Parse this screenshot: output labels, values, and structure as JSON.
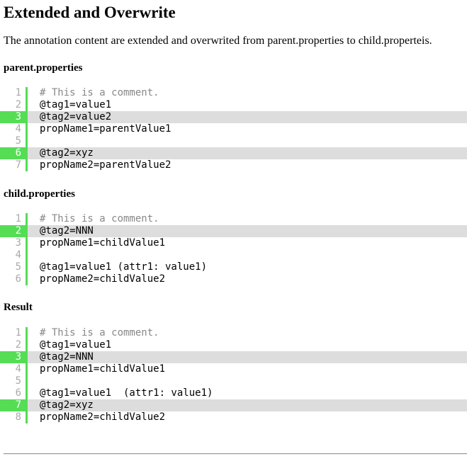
{
  "title": "Extended and Overwrite",
  "intro": "The annotation content are extended and overwrited from parent.properties to child.properteis.",
  "sections": [
    {
      "heading": "parent.properties",
      "lines": [
        {
          "num": "1",
          "text": "# This is a comment.",
          "highlight": false,
          "comment": true
        },
        {
          "num": "2",
          "text": "@tag1=value1",
          "highlight": false,
          "comment": false
        },
        {
          "num": "3",
          "text": "@tag2=value2",
          "highlight": true,
          "comment": false
        },
        {
          "num": "4",
          "text": "propName1=parentValue1",
          "highlight": false,
          "comment": false
        },
        {
          "num": "5",
          "text": "",
          "highlight": false,
          "comment": false
        },
        {
          "num": "6",
          "text": "@tag2=xyz",
          "highlight": true,
          "comment": false
        },
        {
          "num": "7",
          "text": "propName2=parentValue2",
          "highlight": false,
          "comment": false
        }
      ]
    },
    {
      "heading": "child.properties",
      "lines": [
        {
          "num": "1",
          "text": "# This is a comment.",
          "highlight": false,
          "comment": true
        },
        {
          "num": "2",
          "text": "@tag2=NNN",
          "highlight": true,
          "comment": false
        },
        {
          "num": "3",
          "text": "propName1=childValue1",
          "highlight": false,
          "comment": false
        },
        {
          "num": "4",
          "text": "",
          "highlight": false,
          "comment": false
        },
        {
          "num": "5",
          "text": "@tag1=value1 (attr1: value1)",
          "highlight": false,
          "comment": false
        },
        {
          "num": "6",
          "text": "propName2=childValue2",
          "highlight": false,
          "comment": false
        }
      ]
    },
    {
      "heading": "Result",
      "lines": [
        {
          "num": "1",
          "text": "# This is a comment.",
          "highlight": false,
          "comment": true
        },
        {
          "num": "2",
          "text": "@tag1=value1",
          "highlight": false,
          "comment": false
        },
        {
          "num": "3",
          "text": "@tag2=NNN",
          "highlight": true,
          "comment": false
        },
        {
          "num": "4",
          "text": "propName1=childValue1",
          "highlight": false,
          "comment": false
        },
        {
          "num": "5",
          "text": "",
          "highlight": false,
          "comment": false
        },
        {
          "num": "6",
          "text": "@tag1=value1  (attr1: value1)",
          "highlight": false,
          "comment": false
        },
        {
          "num": "7",
          "text": "@tag2=xyz",
          "highlight": true,
          "comment": false
        },
        {
          "num": "8",
          "text": "propName2=childValue2",
          "highlight": false,
          "comment": false
        }
      ]
    }
  ]
}
